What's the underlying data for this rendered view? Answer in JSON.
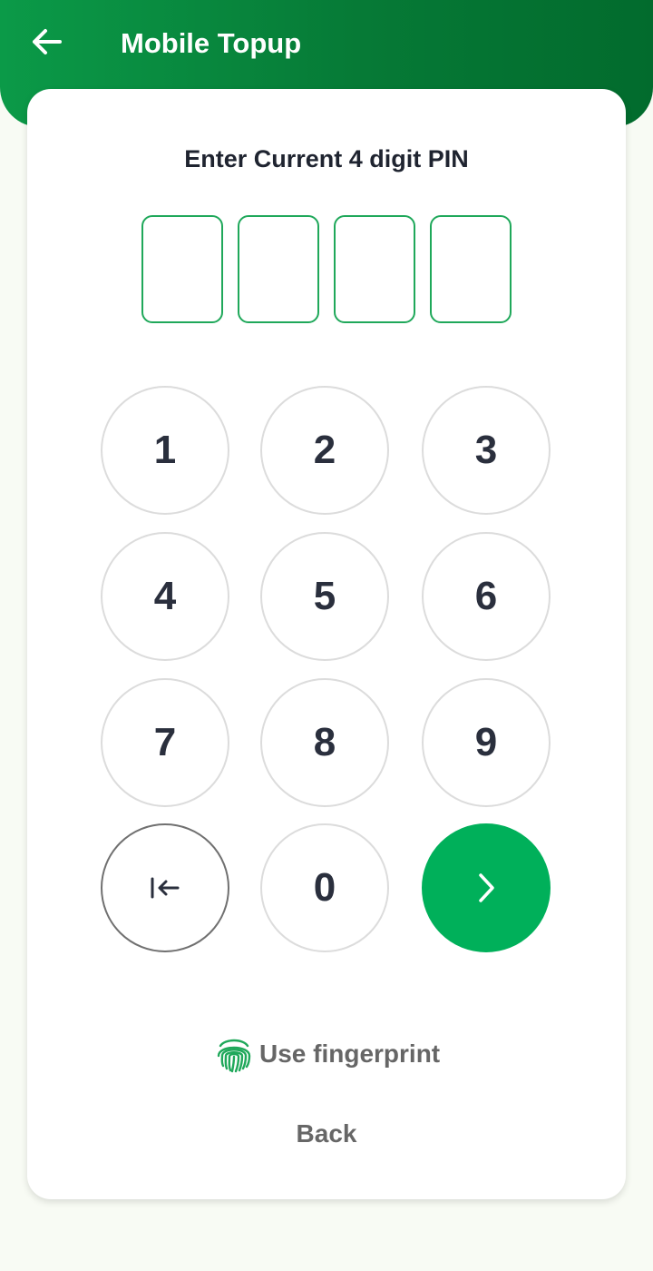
{
  "header": {
    "title": "Mobile Topup",
    "back_icon": "arrow-left-icon",
    "colors": {
      "start": "#0b9a48",
      "end": "#026b2d"
    }
  },
  "pin": {
    "prompt": "Enter Current 4 digit PIN",
    "length": 4,
    "entered": "",
    "box_border_color": "#1fa85a"
  },
  "keypad": {
    "keys": [
      "1",
      "2",
      "3",
      "4",
      "5",
      "6",
      "7",
      "8",
      "9",
      "0"
    ],
    "backspace_icon": "backspace-icon",
    "submit_icon": "chevron-right-icon",
    "submit_color": "#00b05a"
  },
  "fingerprint": {
    "icon": "fingerprint-icon",
    "label": "Use fingerprint",
    "icon_color": "#1fa85a"
  },
  "back_link": {
    "label": "Back"
  }
}
